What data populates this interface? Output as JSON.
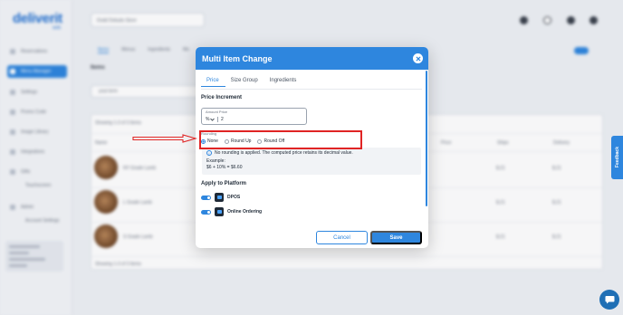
{
  "app": {
    "logo": "deliverit",
    "logo_sub": "web",
    "store_select": "Dodd Debuits Store",
    "sidebar": [
      {
        "label": "Reservations"
      },
      {
        "label": "Menu Manager"
      },
      {
        "label": "Settings"
      },
      {
        "label": "Promo Code"
      },
      {
        "label": "Image Library"
      },
      {
        "label": "Integrations"
      },
      {
        "label": "Gifts"
      },
      {
        "label": "Touchscreen"
      },
      {
        "label": "Admin"
      },
      {
        "label": "Account Settings"
      }
    ],
    "bg_tabs": [
      "Items",
      "Menus",
      "Ingredients",
      "Mo"
    ],
    "bg_title": "Items",
    "bg_search": "yout term",
    "bg_showing_top": "Showing 1-3 of 3 items",
    "bg_showing_bottom": "Showing 1-3 of 3 items",
    "bg_col_name": "Name",
    "bg_col_price": "Price",
    "bg_col_ship": "Ships",
    "bg_col_delivery": "Delivery",
    "bg_items": [
      "NY Grade Lamb",
      "L Grade Lamb",
      "S Grade Lamb"
    ],
    "bg_price": "$.21"
  },
  "modal": {
    "title": "Multi Item Change",
    "tabs": [
      {
        "label": "Price",
        "active": true
      },
      {
        "label": "Size Group",
        "active": false
      },
      {
        "label": "Ingredients",
        "active": false
      }
    ],
    "price_increment": {
      "title": "Price Increment",
      "amount_label": "Amount Price",
      "unit": "%",
      "value": "2"
    },
    "rounding": {
      "label": "Rounding",
      "options": [
        {
          "label": "None",
          "checked": true
        },
        {
          "label": "Round Up",
          "checked": false
        },
        {
          "label": "Round Off",
          "checked": false
        }
      ],
      "info_text": "No rounding is applied. The computed price retains its decimal value.",
      "example_label": "Example:",
      "example_calc": "$6 + 10% = $6.60"
    },
    "apply_to_platform": {
      "title": "Apply to Platform",
      "platforms": [
        {
          "name": "DPOS",
          "enabled": true
        },
        {
          "name": "Online Ordering",
          "enabled": true
        }
      ]
    },
    "cancel_label": "Cancel",
    "save_label": "Save"
  },
  "feedback_label": "Feedback",
  "colors": {
    "accent": "#2e86de",
    "highlight": "#e02424"
  }
}
